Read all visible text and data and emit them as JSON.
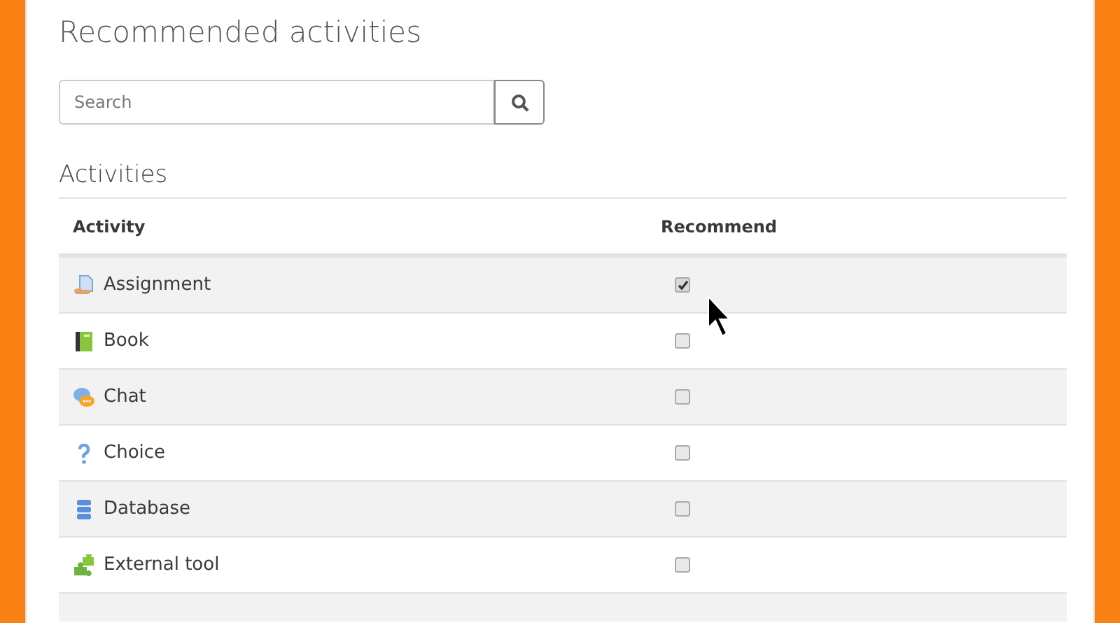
{
  "title": "Recommended activities",
  "search": {
    "placeholder": "Search"
  },
  "section": "Activities",
  "table": {
    "columns": [
      "Activity",
      "Recommend"
    ],
    "rows": [
      {
        "kind": "assignment",
        "name": "Assignment",
        "checked": true
      },
      {
        "kind": "book",
        "name": "Book",
        "checked": false
      },
      {
        "kind": "chat",
        "name": "Chat",
        "checked": false
      },
      {
        "kind": "choice",
        "name": "Choice",
        "checked": false
      },
      {
        "kind": "database",
        "name": "Database",
        "checked": false
      },
      {
        "kind": "tool",
        "name": "External tool",
        "checked": false
      }
    ]
  }
}
